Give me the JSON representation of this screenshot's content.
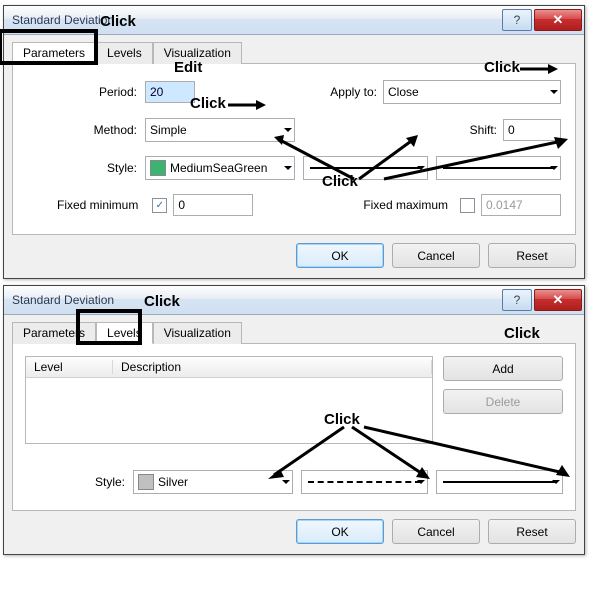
{
  "dialog1": {
    "title": "Standard Deviation",
    "tabs": [
      "Parameters",
      "Levels",
      "Visualization"
    ],
    "periodLabel": "Period:",
    "period": "20",
    "applyToLabel": "Apply to:",
    "applyTo": "Close",
    "methodLabel": "Method:",
    "method": "Simple",
    "shiftLabel": "Shift:",
    "shift": "0",
    "styleLabel": "Style:",
    "color": "MediumSeaGreen",
    "colorHex": "#3cb371",
    "fixedMinLabel": "Fixed minimum",
    "fixedMin": "0",
    "fixedMinChecked": true,
    "fixedMaxLabel": "Fixed maximum",
    "fixedMax": "0.0147",
    "fixedMaxChecked": false,
    "ok": "OK",
    "cancel": "Cancel",
    "reset": "Reset"
  },
  "dialog2": {
    "title": "Standard Deviation",
    "tabs": [
      "Parameters",
      "Levels",
      "Visualization"
    ],
    "colLevel": "Level",
    "colDesc": "Description",
    "add": "Add",
    "delete": "Delete",
    "styleLabel": "Style:",
    "color": "Silver",
    "colorHex": "#c0c0c0",
    "ok": "OK",
    "cancel": "Cancel",
    "reset": "Reset"
  },
  "ann": {
    "click": "Click",
    "edit": "Edit"
  }
}
